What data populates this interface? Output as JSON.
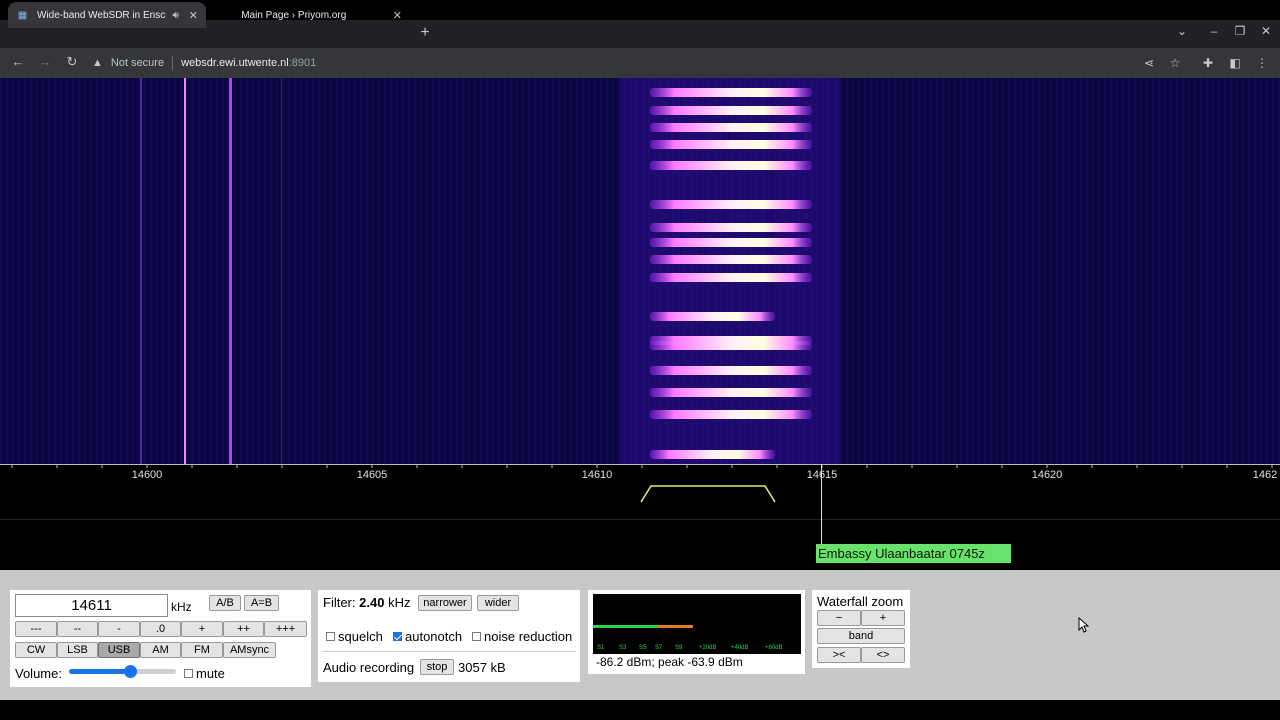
{
  "browser": {
    "tabs": [
      {
        "title": "Wide-band WebSDR in Ensche",
        "active": true
      },
      {
        "title": "Main Page › Priyom.org",
        "active": false
      }
    ],
    "url": {
      "security": "Not secure",
      "host": "websdr.ewi.utwente.nl",
      "port": ":8901"
    }
  },
  "scale": {
    "ticks": [
      "14600",
      "14605",
      "14610",
      "14615",
      "14620",
      "1462"
    ]
  },
  "station_label": "Embassy Ulaanbaatar 0745z",
  "controls": {
    "frequency": "14611",
    "freq_unit": "kHz",
    "ab": "A/B",
    "aeqb": "A=B",
    "step_buttons": [
      "---",
      "--",
      "-",
      ".0",
      "+",
      "++",
      "+++"
    ],
    "modes": [
      "CW",
      "LSB",
      "USB",
      "AM",
      "FM",
      "AMsync"
    ],
    "selected_mode": "USB",
    "volume_label": "Volume:",
    "volume_level": 0.57,
    "mute_label": "mute"
  },
  "filter": {
    "label": "Filter:",
    "value": "2.40",
    "unit": "kHz",
    "narrower": "narrower",
    "wider": "wider",
    "squelch": "squelch",
    "autonotch": "autonotch",
    "noise_reduction": "noise reduction",
    "audio_recording": "Audio recording",
    "stop": "stop",
    "rec_size": "3057 kB"
  },
  "smeter": {
    "scale_labels": [
      "S1",
      "S3",
      "S5",
      "S7",
      "S9",
      "+20dB",
      "+40dB",
      "+60dB"
    ],
    "reading": "-86.2 dBm; peak  -63.9 dBm"
  },
  "waterfall_zoom": {
    "title": "Waterfall zoom",
    "minus": "−",
    "plus": "+",
    "band": "band",
    "narrow": "><",
    "wide": "<>"
  },
  "colors": {
    "station_bg": "#69e26b",
    "waterfall_bg": "#0b0740",
    "passband": "#e8e86a"
  }
}
